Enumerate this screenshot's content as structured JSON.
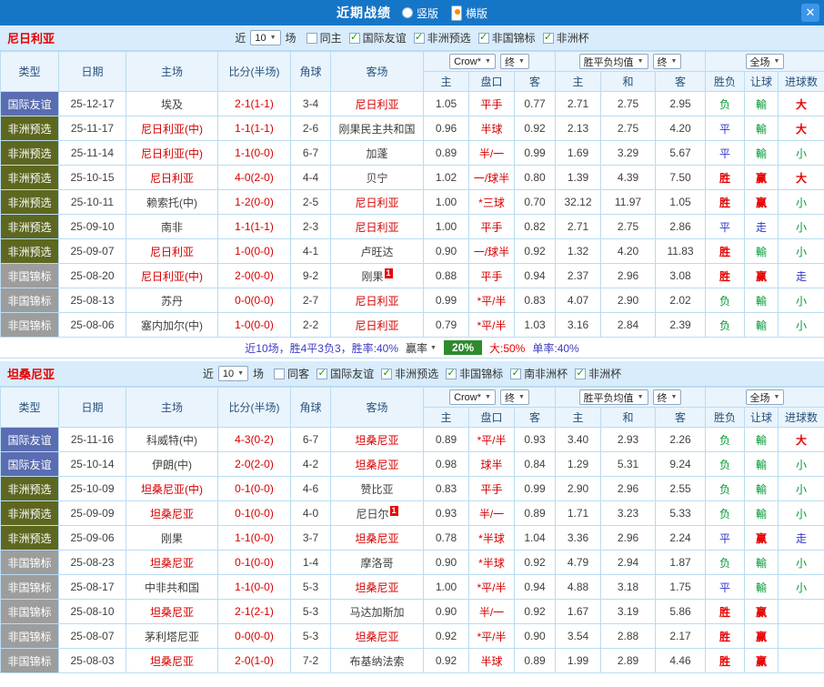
{
  "top_bar": {
    "title": "近期战绩",
    "radios": [
      {
        "label": "竖版",
        "selected": false
      },
      {
        "label": "横版",
        "selected": true
      }
    ],
    "close_icon": "✕"
  },
  "table_header": {
    "type": "类型",
    "date": "日期",
    "home": "主场",
    "score": "比分(半场)",
    "corner": "角球",
    "away": "客场",
    "odds_source": "Crow*",
    "final": "终",
    "avg": "胜平负均值",
    "full": "全场",
    "sub": {
      "home": "主",
      "handicap": "盘口",
      "away": "客",
      "win": "主",
      "draw": "和",
      "lose": "客",
      "result": "胜负",
      "letgoal": "让球",
      "goals": "进球数"
    }
  },
  "colors": {
    "type": {
      "国际友谊": "#5a6db2",
      "非洲预选": "#5d671f",
      "非国锦标": "#9d9d9d"
    },
    "result": {
      "胜": "#e60000",
      "赢": "#e60000",
      "大": "#e60000",
      "负": "#019934",
      "輸": "#019934",
      "小": "#019934",
      "平": "#2d35c8",
      "走": "#2d35c8"
    },
    "badge_green": "#2e8b2e"
  },
  "sections": [
    {
      "team": "尼日利亚",
      "filter": {
        "near": "近",
        "count": "10",
        "unit": "场",
        "checkboxes": [
          {
            "label": "同主",
            "checked": false
          },
          {
            "label": "国际友谊",
            "checked": true
          },
          {
            "label": "非洲预选",
            "checked": true
          },
          {
            "label": "非国锦标",
            "checked": true
          },
          {
            "label": "非洲杯",
            "checked": true
          }
        ]
      },
      "rows": [
        {
          "type": "国际友谊",
          "date": "25-12-17",
          "home": "埃及",
          "score": "2-1(1-1)",
          "corner": "3-4",
          "away": "尼日利亚",
          "away_red": true,
          "odds_home": "1.05",
          "handicap": "平手",
          "odds_away": "0.77",
          "avg_win": "2.71",
          "avg_draw": "2.75",
          "avg_lose": "2.95",
          "result": "负",
          "letgoal": "輸",
          "goals": "大"
        },
        {
          "type": "非洲预选",
          "date": "25-11-17",
          "home": "尼日利亚(中)",
          "home_red": true,
          "score": "1-1(1-1)",
          "corner": "2-6",
          "away": "刚果民主共和国",
          "odds_home": "0.96",
          "handicap": "半球",
          "odds_away": "0.92",
          "avg_win": "2.13",
          "avg_draw": "2.75",
          "avg_lose": "4.20",
          "result": "平",
          "letgoal": "輸",
          "goals": "大"
        },
        {
          "type": "非洲预选",
          "date": "25-11-14",
          "home": "尼日利亚(中)",
          "home_red": true,
          "score": "1-1(0-0)",
          "corner": "6-7",
          "away": "加蓬",
          "odds_home": "0.89",
          "handicap": "半/一",
          "odds_away": "0.99",
          "avg_win": "1.69",
          "avg_draw": "3.29",
          "avg_lose": "5.67",
          "result": "平",
          "letgoal": "輸",
          "goals": "小"
        },
        {
          "type": "非洲预选",
          "date": "25-10-15",
          "home": "尼日利亚",
          "home_red": true,
          "score": "4-0(2-0)",
          "corner": "4-4",
          "away": "贝宁",
          "odds_home": "1.02",
          "handicap": "一/球半",
          "odds_away": "0.80",
          "avg_win": "1.39",
          "avg_draw": "4.39",
          "avg_lose": "7.50",
          "result": "胜",
          "letgoal": "赢",
          "goals": "大"
        },
        {
          "type": "非洲预选",
          "date": "25-10-11",
          "home": "赖索托(中)",
          "score": "1-2(0-0)",
          "corner": "2-5",
          "away": "尼日利亚",
          "away_red": true,
          "odds_home": "1.00",
          "handicap": "*三球",
          "odds_away": "0.70",
          "avg_win": "32.12",
          "avg_draw": "11.97",
          "avg_lose": "1.05",
          "result": "胜",
          "letgoal": "赢",
          "goals": "小"
        },
        {
          "type": "非洲预选",
          "date": "25-09-10",
          "home": "南非",
          "score": "1-1(1-1)",
          "corner": "2-3",
          "away": "尼日利亚",
          "away_red": true,
          "odds_home": "1.00",
          "handicap": "平手",
          "odds_away": "0.82",
          "avg_win": "2.71",
          "avg_draw": "2.75",
          "avg_lose": "2.86",
          "result": "平",
          "letgoal": "走",
          "goals": "小"
        },
        {
          "type": "非洲预选",
          "date": "25-09-07",
          "home": "尼日利亚",
          "home_red": true,
          "score": "1-0(0-0)",
          "corner": "4-1",
          "away": "卢旺达",
          "odds_home": "0.90",
          "handicap": "一/球半",
          "odds_away": "0.92",
          "avg_win": "1.32",
          "avg_draw": "4.20",
          "avg_lose": "11.83",
          "result": "胜",
          "letgoal": "輸",
          "goals": "小"
        },
        {
          "type": "非国锦标",
          "date": "25-08-20",
          "home": "尼日利亚(中)",
          "home_red": true,
          "score": "2-0(0-0)",
          "corner": "9-2",
          "away": "刚果",
          "away_badge": "1",
          "odds_home": "0.88",
          "handicap": "平手",
          "odds_away": "0.94",
          "avg_win": "2.37",
          "avg_draw": "2.96",
          "avg_lose": "3.08",
          "result": "胜",
          "letgoal": "赢",
          "goals": "走"
        },
        {
          "type": "非国锦标",
          "date": "25-08-13",
          "home": "苏丹",
          "score": "0-0(0-0)",
          "corner": "2-7",
          "away": "尼日利亚",
          "away_red": true,
          "odds_home": "0.99",
          "handicap": "*平/半",
          "odds_away": "0.83",
          "avg_win": "4.07",
          "avg_draw": "2.90",
          "avg_lose": "2.02",
          "result": "负",
          "letgoal": "輸",
          "goals": "小"
        },
        {
          "type": "非国锦标",
          "date": "25-08-06",
          "home": "塞内加尔(中)",
          "score": "1-0(0-0)",
          "corner": "2-2",
          "away": "尼日利亚",
          "away_red": true,
          "odds_home": "0.79",
          "handicap": "*平/半",
          "odds_away": "1.03",
          "avg_win": "3.16",
          "avg_draw": "2.84",
          "avg_lose": "2.39",
          "result": "负",
          "letgoal": "輸",
          "goals": "小"
        }
      ],
      "summary": {
        "text": "近10场，胜4平3负3，胜率:40%",
        "rate_label": "赢率",
        "rate_value": "20%",
        "big": "大:50%",
        "single": "单率:40%"
      }
    },
    {
      "team": "坦桑尼亚",
      "filter": {
        "near": "近",
        "count": "10",
        "unit": "场",
        "checkboxes": [
          {
            "label": "同客",
            "checked": false
          },
          {
            "label": "国际友谊",
            "checked": true
          },
          {
            "label": "非洲预选",
            "checked": true
          },
          {
            "label": "非国锦标",
            "checked": true
          },
          {
            "label": "南非洲杯",
            "checked": true
          },
          {
            "label": "非洲杯",
            "checked": true
          }
        ]
      },
      "rows": [
        {
          "type": "国际友谊",
          "date": "25-11-16",
          "home": "科威特(中)",
          "score": "4-3(0-2)",
          "corner": "6-7",
          "away": "坦桑尼亚",
          "away_red": true,
          "odds_home": "0.89",
          "handicap": "*平/半",
          "odds_away": "0.93",
          "avg_win": "3.40",
          "avg_draw": "2.93",
          "avg_lose": "2.26",
          "result": "负",
          "letgoal": "輸",
          "goals": "大"
        },
        {
          "type": "国际友谊",
          "date": "25-10-14",
          "home": "伊朗(中)",
          "score": "2-0(2-0)",
          "corner": "4-2",
          "away": "坦桑尼亚",
          "away_red": true,
          "odds_home": "0.98",
          "handicap": "球半",
          "odds_away": "0.84",
          "avg_win": "1.29",
          "avg_draw": "5.31",
          "avg_lose": "9.24",
          "result": "负",
          "letgoal": "輸",
          "goals": "小"
        },
        {
          "type": "非洲预选",
          "date": "25-10-09",
          "home": "坦桑尼亚(中)",
          "home_red": true,
          "score": "0-1(0-0)",
          "corner": "4-6",
          "away": "赞比亚",
          "odds_home": "0.83",
          "handicap": "平手",
          "odds_away": "0.99",
          "avg_win": "2.90",
          "avg_draw": "2.96",
          "avg_lose": "2.55",
          "result": "负",
          "letgoal": "輸",
          "goals": "小"
        },
        {
          "type": "非洲预选",
          "date": "25-09-09",
          "home": "坦桑尼亚",
          "home_red": true,
          "score": "0-1(0-0)",
          "corner": "4-0",
          "away": "尼日尔",
          "away_badge": "1",
          "odds_home": "0.93",
          "handicap": "半/一",
          "odds_away": "0.89",
          "avg_win": "1.71",
          "avg_draw": "3.23",
          "avg_lose": "5.33",
          "result": "负",
          "letgoal": "輸",
          "goals": "小"
        },
        {
          "type": "非洲预选",
          "date": "25-09-06",
          "home": "刚果",
          "score": "1-1(0-0)",
          "corner": "3-7",
          "away": "坦桑尼亚",
          "away_red": true,
          "odds_home": "0.78",
          "handicap": "*半球",
          "odds_away": "1.04",
          "avg_win": "3.36",
          "avg_draw": "2.96",
          "avg_lose": "2.24",
          "result": "平",
          "letgoal": "赢",
          "goals": "走"
        },
        {
          "type": "非国锦标",
          "date": "25-08-23",
          "home": "坦桑尼亚",
          "home_red": true,
          "score": "0-1(0-0)",
          "corner": "1-4",
          "away": "摩洛哥",
          "odds_home": "0.90",
          "handicap": "*半球",
          "odds_away": "0.92",
          "avg_win": "4.79",
          "avg_draw": "2.94",
          "avg_lose": "1.87",
          "result": "负",
          "letgoal": "輸",
          "goals": "小"
        },
        {
          "type": "非国锦标",
          "date": "25-08-17",
          "home": "中非共和国",
          "score": "1-1(0-0)",
          "corner": "5-3",
          "away": "坦桑尼亚",
          "away_red": true,
          "odds_home": "1.00",
          "handicap": "*平/半",
          "odds_away": "0.94",
          "avg_win": "4.88",
          "avg_draw": "3.18",
          "avg_lose": "1.75",
          "result": "平",
          "letgoal": "輸",
          "goals": "小"
        },
        {
          "type": "非国锦标",
          "date": "25-08-10",
          "home": "坦桑尼亚",
          "home_red": true,
          "score": "2-1(2-1)",
          "corner": "5-3",
          "away": "马达加斯加",
          "odds_home": "0.90",
          "handicap": "半/一",
          "odds_away": "0.92",
          "avg_win": "1.67",
          "avg_draw": "3.19",
          "avg_lose": "5.86",
          "result": "胜",
          "letgoal": "赢",
          "goals": ""
        },
        {
          "type": "非国锦标",
          "date": "25-08-07",
          "home": "茅利塔尼亚",
          "score": "0-0(0-0)",
          "corner": "5-3",
          "away": "坦桑尼亚",
          "away_red": true,
          "odds_home": "0.92",
          "handicap": "*平/半",
          "odds_away": "0.90",
          "avg_win": "3.54",
          "avg_draw": "2.88",
          "avg_lose": "2.17",
          "result": "胜",
          "letgoal": "赢",
          "goals": ""
        },
        {
          "type": "非国锦标",
          "date": "25-08-03",
          "home": "坦桑尼亚",
          "home_red": true,
          "score": "2-0(1-0)",
          "corner": "7-2",
          "away": "布基纳法索",
          "odds_home": "0.92",
          "handicap": "半球",
          "odds_away": "0.89",
          "avg_win": "1.99",
          "avg_draw": "2.89",
          "avg_lose": "4.46",
          "result": "胜",
          "letgoal": "赢",
          "goals": ""
        }
      ]
    }
  ]
}
